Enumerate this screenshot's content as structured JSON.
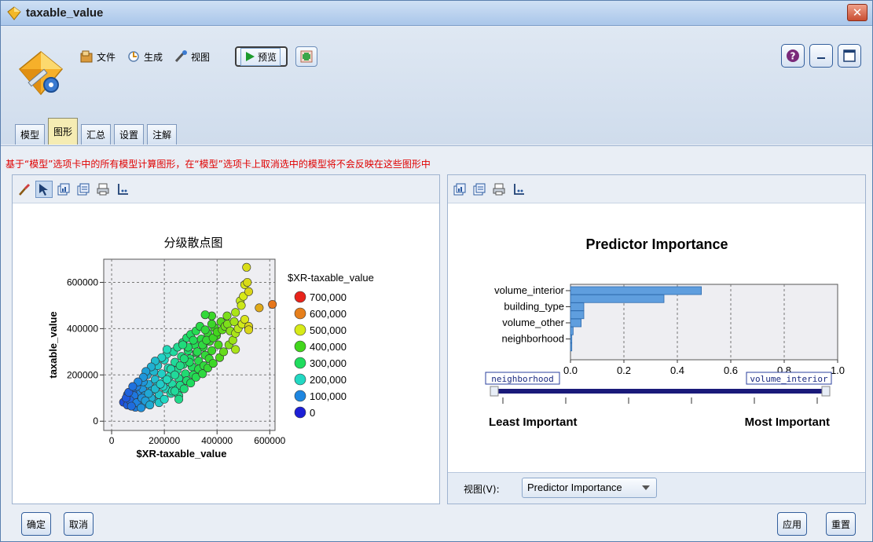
{
  "window": {
    "title": "taxable_value"
  },
  "toolbar": {
    "file_label": "文件",
    "generate_label": "生成",
    "view_label": "视图",
    "preview_label": "预览"
  },
  "tabs": [
    {
      "label": "模型",
      "active": false
    },
    {
      "label": "图形",
      "active": true
    },
    {
      "label": "汇总",
      "active": false
    },
    {
      "label": "设置",
      "active": false
    },
    {
      "label": "注解",
      "active": false
    }
  ],
  "notice": "基于“模型”选项卡中的所有模型计算图形，在“模型”选项卡上取消选中的模型将不会反映在这些图形中",
  "view_bar": {
    "label": "视图(V):",
    "selected": "Predictor Importance"
  },
  "footer": {
    "ok": "确定",
    "cancel": "取消",
    "apply": "应用",
    "reset": "重置"
  },
  "chart_data": [
    {
      "type": "scatter",
      "title": "分级散点图",
      "xlabel": "$XR-taxable_value",
      "ylabel": "taxable_value",
      "xlim": [
        -30000,
        620000
      ],
      "ylim": [
        -40000,
        700000
      ],
      "x_ticks": [
        0,
        200000,
        400000,
        600000
      ],
      "x_tick_labels": [
        "0",
        "200000",
        "400000",
        "600000"
      ],
      "y_ticks": [
        0,
        200000,
        400000,
        600000
      ],
      "y_tick_labels": [
        "0",
        "200000",
        "400000",
        "600000"
      ],
      "grid": true,
      "legend_title": "$XR-taxable_value",
      "legend_position": "right",
      "legend": [
        {
          "label": "700,000",
          "color": "#e8231b"
        },
        {
          "label": "600,000",
          "color": "#e67f1b"
        },
        {
          "label": "500,000",
          "color": "#d7ea18"
        },
        {
          "label": "400,000",
          "color": "#42d61c"
        },
        {
          "label": "300,000",
          "color": "#1fdc5e"
        },
        {
          "label": "200,000",
          "color": "#22d8c2"
        },
        {
          "label": "100,000",
          "color": "#1e86e0"
        },
        {
          "label": "0",
          "color": "#1d1fd6"
        }
      ],
      "points": [
        [
          45000,
          82000
        ],
        [
          60000,
          70000
        ],
        [
          72000,
          105000
        ],
        [
          85000,
          95000
        ],
        [
          90000,
          60000
        ],
        [
          100000,
          120000
        ],
        [
          110000,
          88000
        ],
        [
          118000,
          140000
        ],
        [
          125000,
          110000
        ],
        [
          130000,
          75000
        ],
        [
          140000,
          160000
        ],
        [
          150000,
          130000
        ],
        [
          155000,
          95000
        ],
        [
          165000,
          180000
        ],
        [
          172000,
          150000
        ],
        [
          180000,
          115000
        ],
        [
          190000,
          205000
        ],
        [
          198000,
          170000
        ],
        [
          205000,
          140000
        ],
        [
          215000,
          230000
        ],
        [
          222000,
          195000
        ],
        [
          230000,
          160000
        ],
        [
          240000,
          255000
        ],
        [
          248000,
          220000
        ],
        [
          255000,
          185000
        ],
        [
          265000,
          280000
        ],
        [
          272000,
          245000
        ],
        [
          280000,
          205000
        ],
        [
          290000,
          305000
        ],
        [
          298000,
          270000
        ],
        [
          305000,
          235000
        ],
        [
          315000,
          330000
        ],
        [
          322000,
          295000
        ],
        [
          330000,
          260000
        ],
        [
          340000,
          355000
        ],
        [
          348000,
          320000
        ],
        [
          355000,
          285000
        ],
        [
          365000,
          380000
        ],
        [
          372000,
          345000
        ],
        [
          380000,
          305000
        ],
        [
          390000,
          405000
        ],
        [
          398000,
          370000
        ],
        [
          405000,
          330000
        ],
        [
          415000,
          430000
        ],
        [
          60000,
          115000
        ],
        [
          80000,
          130000
        ],
        [
          95000,
          150000
        ],
        [
          120000,
          170000
        ],
        [
          135000,
          200000
        ],
        [
          160000,
          215000
        ],
        [
          175000,
          240000
        ],
        [
          200000,
          265000
        ],
        [
          210000,
          290000
        ],
        [
          235000,
          300000
        ],
        [
          250000,
          320000
        ],
        [
          270000,
          340000
        ],
        [
          285000,
          360000
        ],
        [
          300000,
          375000
        ],
        [
          320000,
          390000
        ],
        [
          335000,
          410000
        ],
        [
          180000,
          80000
        ],
        [
          200000,
          95000
        ],
        [
          225000,
          120000
        ],
        [
          250000,
          140000
        ],
        [
          260000,
          155000
        ],
        [
          285000,
          175000
        ],
        [
          310000,
          200000
        ],
        [
          330000,
          225000
        ],
        [
          350000,
          240000
        ],
        [
          370000,
          270000
        ],
        [
          225000,
          225000
        ],
        [
          260000,
          240000
        ],
        [
          295000,
          255000
        ],
        [
          325000,
          300000
        ],
        [
          345000,
          330000
        ],
        [
          360000,
          350000
        ],
        [
          385000,
          360000
        ],
        [
          400000,
          385000
        ],
        [
          420000,
          395000
        ],
        [
          430000,
          410000
        ],
        [
          440000,
          420000
        ],
        [
          450000,
          390000
        ],
        [
          380000,
          420000
        ],
        [
          355000,
          395000
        ],
        [
          310000,
          350000
        ],
        [
          290000,
          320000
        ],
        [
          275000,
          270000
        ],
        [
          240000,
          200000
        ],
        [
          195000,
          150000
        ],
        [
          150000,
          100000
        ],
        [
          105000,
          75000
        ],
        [
          85000,
          110000
        ],
        [
          70000,
          90000
        ],
        [
          55000,
          100000
        ],
        [
          65000,
          125000
        ],
        [
          95000,
          80000
        ],
        [
          115000,
          100000
        ],
        [
          140000,
          120000
        ],
        [
          165000,
          140000
        ],
        [
          185000,
          160000
        ],
        [
          210000,
          180000
        ],
        [
          230000,
          130000
        ],
        [
          255000,
          110000
        ],
        [
          275000,
          140000
        ],
        [
          300000,
          165000
        ],
        [
          320000,
          190000
        ],
        [
          345000,
          205000
        ],
        [
          365000,
          230000
        ],
        [
          385000,
          250000
        ],
        [
          410000,
          275000
        ],
        [
          425000,
          300000
        ],
        [
          445000,
          330000
        ],
        [
          460000,
          350000
        ],
        [
          470000,
          380000
        ],
        [
          480000,
          400000
        ],
        [
          495000,
          420000
        ],
        [
          465000,
          430000
        ],
        [
          438000,
          455000
        ],
        [
          470000,
          470000
        ],
        [
          488000,
          520000
        ],
        [
          500000,
          540000
        ],
        [
          505000,
          590000
        ],
        [
          515000,
          600000
        ],
        [
          520000,
          560000
        ],
        [
          492000,
          500000
        ],
        [
          505000,
          440000
        ],
        [
          520000,
          400000
        ],
        [
          520000,
          410000
        ],
        [
          470000,
          310000
        ],
        [
          560000,
          490000
        ],
        [
          512000,
          665000
        ],
        [
          610000,
          505000
        ],
        [
          520000,
          395000
        ],
        [
          380000,
          455000
        ],
        [
          355000,
          460000
        ],
        [
          240000,
          130000
        ],
        [
          255000,
          95000
        ],
        [
          270000,
          330000
        ],
        [
          210000,
          310000
        ],
        [
          190000,
          275000
        ],
        [
          165000,
          260000
        ],
        [
          150000,
          235000
        ],
        [
          130000,
          215000
        ],
        [
          120000,
          190000
        ],
        [
          100000,
          170000
        ],
        [
          80000,
          150000
        ],
        [
          75000,
          65000
        ],
        [
          112000,
          58000
        ],
        [
          128000,
          88000
        ],
        [
          145000,
          70000
        ]
      ]
    },
    {
      "type": "bar",
      "orientation": "horizontal",
      "title": "Predictor Importance",
      "categories": [
        "volume_interior",
        "",
        "building_type",
        "",
        "volume_other",
        "",
        "neighborhood",
        ""
      ],
      "y_tick_labels": [
        "volume_interior",
        "building_type",
        "volume_other",
        "neighborhood"
      ],
      "values": [
        0.49,
        0.35,
        0.05,
        0.05,
        0.04,
        0.01,
        0.005,
        0.005
      ],
      "xlim": [
        0,
        1.0
      ],
      "x_ticks": [
        0.0,
        0.2,
        0.4,
        0.6,
        0.8,
        1.0
      ],
      "x_tick_labels": [
        "0.0",
        "0.2",
        "0.4",
        "0.6",
        "0.8",
        "1.0"
      ],
      "grid": true,
      "slider": {
        "min_label": "neighborhood",
        "max_label": "volume_interior",
        "least_label": "Least Important",
        "most_label": "Most Important"
      }
    }
  ]
}
